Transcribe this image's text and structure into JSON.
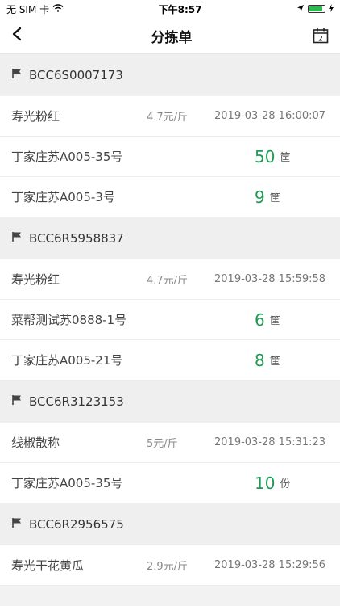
{
  "status": {
    "carrier": "无 SIM 卡",
    "time": "下午8:57",
    "battery_level": 0.9
  },
  "nav": {
    "title": "分拣单",
    "back_icon": "chevron-left-icon",
    "calendar_icon": "calendar-icon",
    "calendar_day": "2"
  },
  "groups": [
    {
      "code": "BCC6S0007173",
      "product": {
        "name": "寿光粉红",
        "price": "4.7元/斤",
        "time": "2019-03-28 16:00:07"
      },
      "items": [
        {
          "name": "丁家庄苏A005-35号",
          "qty": "50",
          "unit": "筐"
        },
        {
          "name": "丁家庄苏A005-3号",
          "qty": "9",
          "unit": "筐"
        }
      ]
    },
    {
      "code": "BCC6R5958837",
      "product": {
        "name": "寿光粉红",
        "price": "4.7元/斤",
        "time": "2019-03-28 15:59:58"
      },
      "items": [
        {
          "name": "菜帮测试苏0888-1号",
          "qty": "6",
          "unit": "筐"
        },
        {
          "name": "丁家庄苏A005-21号",
          "qty": "8",
          "unit": "筐"
        }
      ]
    },
    {
      "code": "BCC6R3123153",
      "product": {
        "name": "线椒散称",
        "price": "5元/斤",
        "time": "2019-03-28 15:31:23"
      },
      "items": [
        {
          "name": "丁家庄苏A005-35号",
          "qty": "10",
          "unit": "份"
        }
      ]
    },
    {
      "code": "BCC6R2956575",
      "product": {
        "name": "寿光干花黄瓜",
        "price": "2.9元/斤",
        "time": "2019-03-28 15:29:56"
      },
      "items": []
    }
  ]
}
